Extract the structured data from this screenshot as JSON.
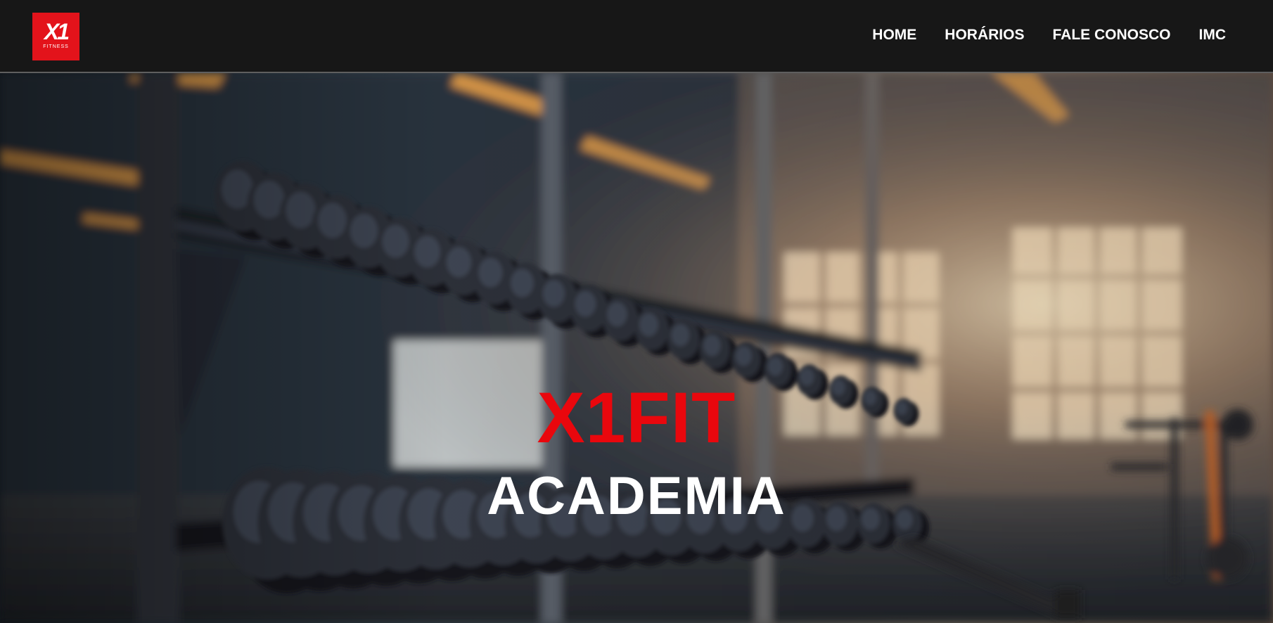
{
  "brand": {
    "logo_mark": "X1",
    "logo_subtext": "FITNESS",
    "logo_color": "#e3131b"
  },
  "nav": {
    "items": [
      {
        "label": "HOME"
      },
      {
        "label": "HORÁRIOS"
      },
      {
        "label": "FALE CONOSCO"
      },
      {
        "label": "IMC"
      }
    ]
  },
  "hero": {
    "title": "X1FIT",
    "subtitle": "ACADEMIA",
    "title_color": "#e9070d",
    "subtitle_color": "#ffffff"
  }
}
